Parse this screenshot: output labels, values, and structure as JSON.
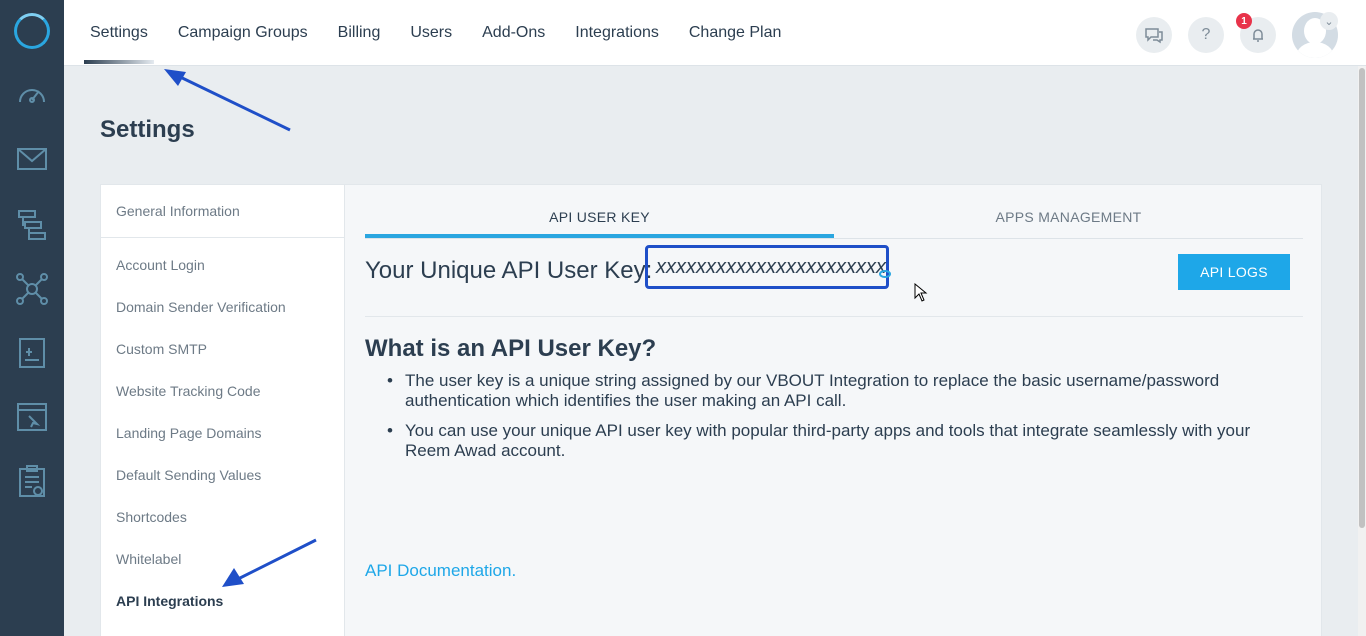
{
  "topnav": {
    "tabs": [
      "Settings",
      "Campaign Groups",
      "Billing",
      "Users",
      "Add-Ons",
      "Integrations",
      "Change Plan"
    ],
    "notification_count": "1",
    "help_glyph": "?"
  },
  "page": {
    "title": "Settings"
  },
  "sidebar": {
    "header": "General Information",
    "items": [
      "Account Login",
      "Domain Sender Verification",
      "Custom SMTP",
      "Website Tracking Code",
      "Landing Page Domains",
      "Default Sending Values",
      "Shortcodes",
      "Whitelabel",
      "API Integrations"
    ]
  },
  "content": {
    "tabs": [
      "API USER KEY",
      "APPS MANAGEMENT"
    ],
    "key_label": "Your Unique API User Key:",
    "key_value": "xxxxxxxxxxxxxxxxxxxxxxx",
    "api_logs": "API LOGS",
    "what_title": "What is an API User Key?",
    "bullets": [
      "The user key is a unique string assigned by our VBOUT Integration to replace the basic username/password authentication which identifies the user making an API call.",
      "You can use your unique API user key with popular third-party apps and tools that integrate seamlessly with your Reem Awad account."
    ],
    "doc_link": "API Documentation."
  },
  "colors": {
    "accent": "#1ea7e8",
    "rail": "#2c3e50",
    "highlight": "#1f4fc8"
  },
  "icons": [
    "dashboard-icon",
    "email-icon",
    "workflow-icon",
    "network-icon",
    "document-icon",
    "browser-icon",
    "clipboard-icon",
    "chat-icon",
    "help-icon",
    "bell-icon",
    "user-avatar-icon"
  ]
}
